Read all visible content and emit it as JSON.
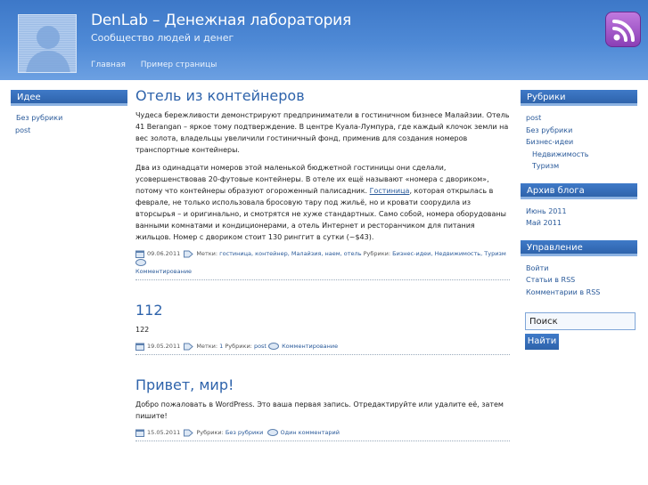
{
  "site": {
    "title": "DenLab – Денежная лаборатория",
    "description": "Сообщество людей и денег",
    "nav": [
      "Главная",
      "Пример страницы"
    ]
  },
  "left_sidebar": {
    "title": "Идее",
    "items": [
      "Без рубрики",
      "post"
    ]
  },
  "right_sidebar": {
    "rubrics_title": "Рубрики",
    "rubrics": [
      {
        "label": "post",
        "sub": false
      },
      {
        "label": "Без рубрики",
        "sub": false
      },
      {
        "label": "Бизнес-идеи",
        "sub": false
      },
      {
        "label": "Недвижимость",
        "sub": true
      },
      {
        "label": "Туризм",
        "sub": true
      }
    ],
    "archive_title": "Архив блога",
    "archive": [
      "Июнь 2011",
      "Май 2011"
    ],
    "manage_title": "Управление",
    "manage": [
      "Войти",
      "Статьи в RSS",
      "Комментарии в RSS"
    ],
    "search_value": "Поиск",
    "search_button": "Найти"
  },
  "posts": [
    {
      "title": "Отель из контейнеров",
      "p1": "Чудеса бережливости демонстрируют предприниматели в гостиничном бизнесе Малайзии. Отель 41 Berangan – яркое тому подтверждение. В центре Куала-Лумпура, где каждый клочок земли на вес золота, владельцы увеличили гостиничный фонд, применив для создания номеров транспортные контейнеры.",
      "p2_a": "Два из одинадцати номеров этой маленькой бюджетной гостиницы они сделали, усовершенствовав 20-футовые контейнеры. В отеле их ещё называют «номера с двориком», потому что контейнеры образуют огороженный палисадник.",
      "p2_link": "Гостиница",
      "p2_b": ", которая открылась в феврале, не только использовала бросовую тару под жильё, но и кровати соорудила из вторсырья – и оригинально, и смотрятся не хуже стандартных. Само собой, номера оборудованы ванными комнатами и кондиционерами, а отель Интернет и ресторанчиком для питания жильцов. Номер с двориком стоит 130 ринггит в сутки (~$43).",
      "date": "09.06.2011",
      "tags_label": "Метки:",
      "tags": "гостиница, контейнер, Малайзия, наем, отель",
      "rubrics_label": "Рубрики:",
      "rubrics": "Бизнес-идеи, Недвижимость, Туризм",
      "comments": "Комментирование"
    },
    {
      "title": "112",
      "body": "122",
      "date": "19.05.2011",
      "tags_label": "Метки:",
      "tags": "1",
      "rubrics_label": "Рубрики:",
      "rubrics": "post",
      "comments": "Комментирование"
    },
    {
      "title": "Привет, мир!",
      "body": "Добро пожаловать в WordPress. Это ваша первая запись. Отредактируйте или удалите её, затем пишите!",
      "date": "15.05.2011",
      "rubrics_label": "Рубрики:",
      "rubrics": "Без рубрики",
      "comments": "Один комментарий"
    }
  ]
}
